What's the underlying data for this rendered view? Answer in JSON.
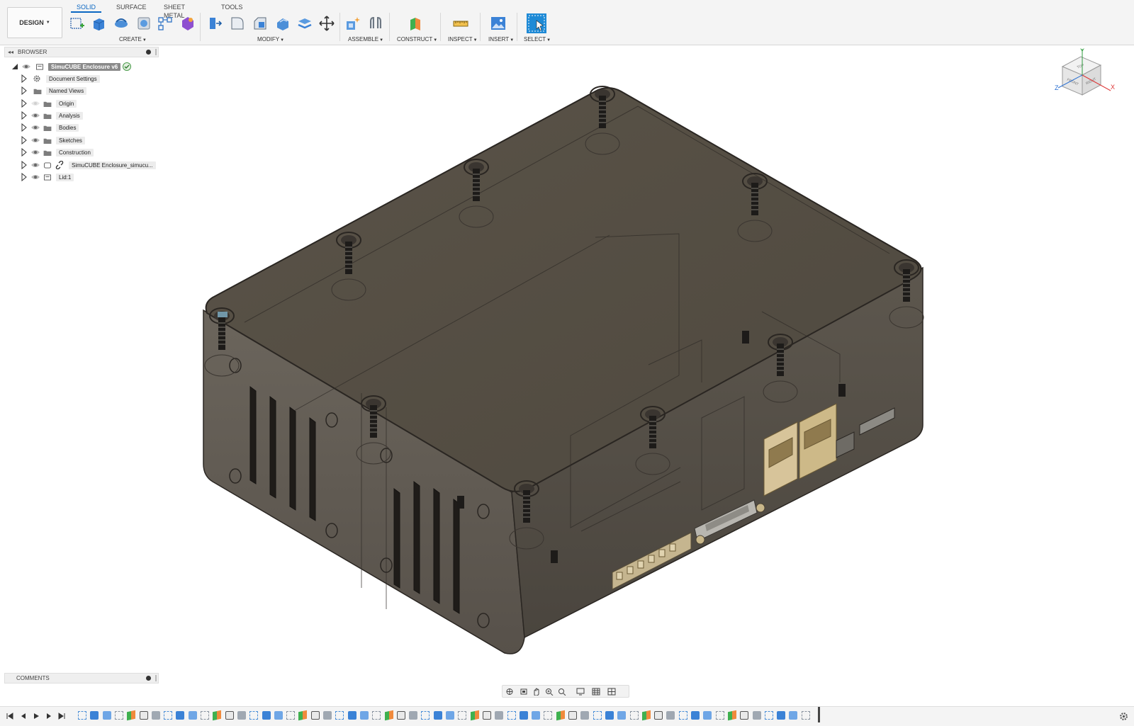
{
  "workspace": {
    "label": "DESIGN"
  },
  "tabs": [
    {
      "label": "SOLID",
      "active": true
    },
    {
      "label": "SURFACE",
      "active": false
    },
    {
      "label": "SHEET METAL",
      "active": false
    },
    {
      "label": "TOOLS",
      "active": false
    }
  ],
  "groups": {
    "create": "CREATE",
    "modify": "MODIFY",
    "assemble": "ASSEMBLE",
    "construct": "CONSTRUCT",
    "inspect": "INSPECT",
    "insert": "INSERT",
    "select": "SELECT"
  },
  "browser": {
    "title": "BROWSER",
    "root": "SimuCUBE Enclosure v6",
    "items": [
      {
        "label": "Document Settings",
        "icon": "gear-icon"
      },
      {
        "label": "Named Views",
        "icon": "folder-icon"
      },
      {
        "label": "Origin",
        "icon": "folder-icon",
        "hidden": true
      },
      {
        "label": "Analysis",
        "icon": "folder-icon"
      },
      {
        "label": "Bodies",
        "icon": "folder-icon"
      },
      {
        "label": "Sketches",
        "icon": "folder-icon"
      },
      {
        "label": "Construction",
        "icon": "folder-icon"
      },
      {
        "label": "SimuCUBE Enclosure_simucu...",
        "icon": "link-icon"
      },
      {
        "label": "Lid:1",
        "icon": "component-icon"
      }
    ]
  },
  "comments": {
    "title": "COMMENTS"
  },
  "viewcube": {
    "faces": [
      "TOP",
      "FRONT",
      "RIGHT"
    ],
    "axes": [
      "X",
      "Y",
      "Z"
    ]
  },
  "colors": {
    "accent": "#0a66c2",
    "model_fill": "#5c5549",
    "model_edge": "#2a2622",
    "connector_tan": "#d7c49a"
  }
}
